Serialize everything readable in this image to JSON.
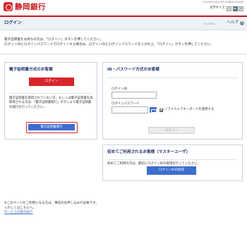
{
  "header": {
    "bank_name": "静岡銀行",
    "datetime": "2XXX年XX月XX日 XX時XX分XX秒",
    "font_size_label": "文字サイズ",
    "font_sizes": [
      "小",
      "中",
      "大"
    ],
    "font_size_selected": "中"
  },
  "titlebar": {
    "title": "ログイン",
    "screen_id": "BLGI001",
    "help_label": "ヘルプ",
    "help_icon": "?"
  },
  "intro": {
    "line1": "電子証明書をお持ちの方は、「ログイン」ボタンを押してください。",
    "line2": "ログインIDとログインパスワードでログインする場合は、ログインIDとログインパスワードを入力の上、「ログイン」ボタンを押してください。"
  },
  "cert_panel": {
    "title": "電子証明書方式のお客様",
    "login_button": "ログイン",
    "note": "電子証明書を取得されていない方、もしくは電子証明書を再取得される方は、「電子証明書発行」ボタンより電子証明書の発行を行ってください。",
    "issue_button": "電子証明書発行"
  },
  "id_panel": {
    "title": "ID・パスワード方式のお客様",
    "login_id_label": "ログインID",
    "login_id_value": "",
    "password_label": "ログインパスワード",
    "password_value": "",
    "software_kbd_label": "ソフトウェアキーボードを使用する",
    "login_button": "ログイン"
  },
  "first_time_panel": {
    "title": "初めてご利用されるお客様（マスターユーザ）",
    "note": "初めてご利用の方は、最初にログインIDの取得を行ってください。",
    "button": "ログインIDの取得"
  },
  "footer": {
    "line1": "※このページをご利用になる方は、事前のお申し込みが必要です。",
    "line2": "くわしくはこちらへ。",
    "link": "サービス内容の紹介"
  },
  "colors": {
    "brand_red": "#d7262b",
    "accent_blue": "#3c6ecf",
    "title_navy": "#1f2f6b"
  }
}
